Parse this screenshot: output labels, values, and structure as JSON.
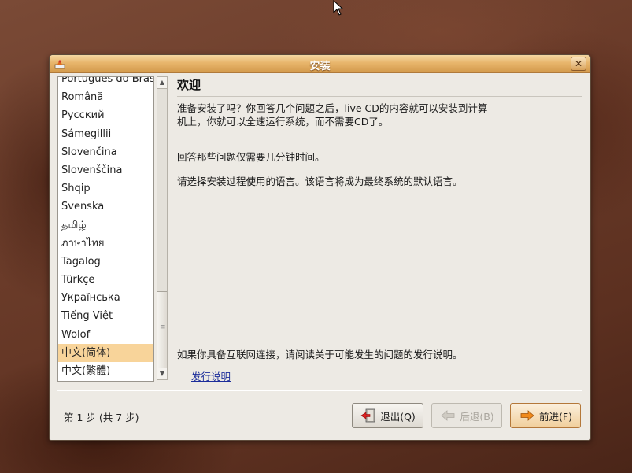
{
  "window": {
    "title": "安装"
  },
  "languages": [
    "Português do Brasil",
    "Română",
    "Русский",
    "Sámegillii",
    "Slovenčina",
    "Slovenščina",
    "Shqip",
    "Svenska",
    "தமிழ்",
    "ภาษาไทย",
    "Tagalog",
    "Türkçe",
    "Українська",
    "Tiếng Việt",
    "Wolof",
    "中文(简体)",
    "中文(繁體)"
  ],
  "selected_language": "中文(简体)",
  "content": {
    "heading": "欢迎",
    "para1": "准备安装了吗？你回答几个问题之后，live CD的内容就可以安装到计算机上，你就可以全速运行系统，而不需要CD了。",
    "para2": "回答那些问题仅需要几分钟时间。",
    "para3": "请选择安装过程使用的语言。该语言将成为最终系统的默认语言。",
    "para4": "如果你具备互联网连接，请阅读关于可能发生的问题的发行说明。",
    "release_notes_link": "发行说明"
  },
  "footer": {
    "step_text": "第 1 步 (共 7 步)",
    "quit_label": "退出(Q)",
    "back_label": "后退(B)",
    "forward_label": "前进(F)"
  },
  "colors": {
    "titlebar": "#e8b56b",
    "selection": "#f8d49a",
    "link": "#1c2d9a"
  }
}
